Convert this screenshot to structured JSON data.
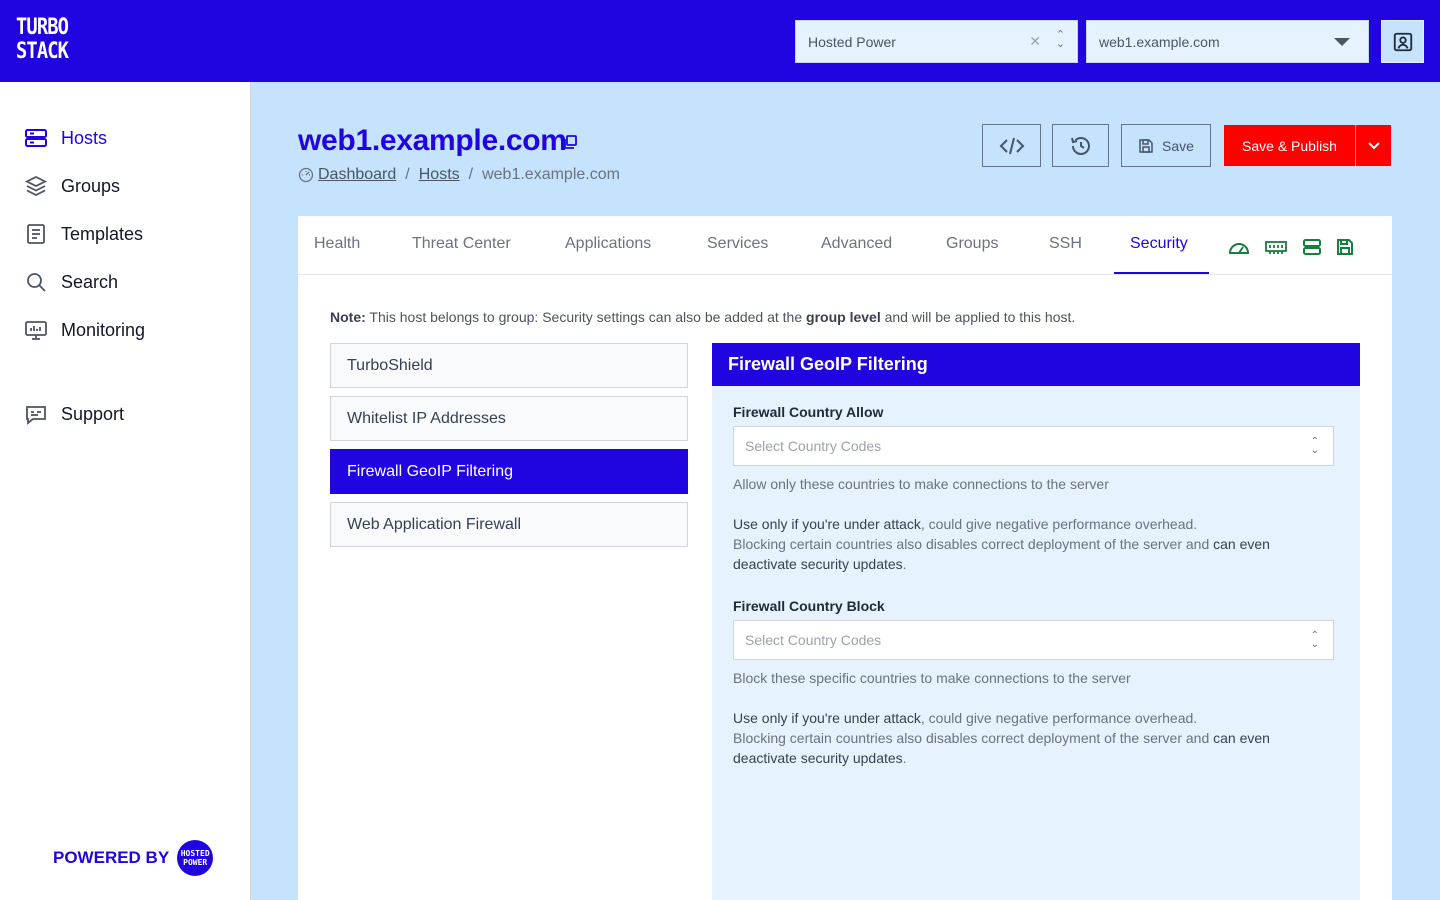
{
  "brand": {
    "logo_line1": "TURBO",
    "logo_line2": "STACK",
    "accent": "#2005e0",
    "danger": "#ff0000",
    "background": "#c5e3fc"
  },
  "topbar": {
    "org_select": {
      "value": "Hosted Power",
      "clear_icon": "close-icon",
      "toggle_icon": "chevron-updown-icon"
    },
    "host_select": {
      "value": "web1.example.com",
      "toggle_icon": "caret-down-icon"
    },
    "user_icon": "user-contact-icon"
  },
  "sidebar": {
    "items": [
      {
        "label": "Hosts",
        "icon": "server-icon",
        "active": true
      },
      {
        "label": "Groups",
        "icon": "layers-icon",
        "active": false
      },
      {
        "label": "Templates",
        "icon": "document-icon",
        "active": false
      },
      {
        "label": "Search",
        "icon": "search-icon",
        "active": false
      },
      {
        "label": "Monitoring",
        "icon": "monitor-icon",
        "active": false
      },
      {
        "label": "Support",
        "icon": "chat-icon",
        "active": false
      }
    ],
    "powered_by": "POWERED BY",
    "powered_logo": "HOSTED POWER"
  },
  "header": {
    "title": "web1.example.com",
    "breadcrumb": [
      "Dashboard",
      "Hosts",
      "web1.example.com"
    ],
    "breadcrumb_sep": "/",
    "save_label": "Save",
    "publish_label": "Save & Publish"
  },
  "tabs": [
    {
      "label": "Health",
      "active": false
    },
    {
      "label": "Threat Center",
      "active": false
    },
    {
      "label": "Applications",
      "active": false
    },
    {
      "label": "Services",
      "active": false
    },
    {
      "label": "Advanced",
      "active": false
    },
    {
      "label": "Groups",
      "active": false
    },
    {
      "label": "SSH",
      "active": false
    },
    {
      "label": "Security",
      "active": true
    }
  ],
  "tab_icons": [
    "gauge-icon",
    "memory-icon",
    "server-icon",
    "floppy-icon"
  ],
  "tab_icon_color": "#15803d",
  "note": {
    "prefix": "Note:",
    "text_before": " This host belongs to group: Security settings can also be added at the ",
    "bold": "group level",
    "text_after": " and will be applied to this host."
  },
  "security_menu": [
    {
      "label": "TurboShield",
      "active": false
    },
    {
      "label": "Whitelist IP Addresses",
      "active": false
    },
    {
      "label": "Firewall GeoIP Filtering",
      "active": true
    },
    {
      "label": "Web Application Firewall",
      "active": false
    }
  ],
  "panel": {
    "title": "Firewall GeoIP Filtering",
    "allow": {
      "label": "Firewall Country Allow",
      "placeholder": "Select Country Codes",
      "help1": "Allow only these countries to make connections to the server",
      "warn_bold": "Use only if you're under attack",
      "warn_rest": ", could give negative performance overhead.",
      "warn2_start": "Blocking certain countries also disables correct deployment of the server and ",
      "warn2_bold": "can even deactivate security updates",
      "warn2_end": "."
    },
    "block": {
      "label": "Firewall Country Block",
      "placeholder": "Select Country Codes",
      "help1": "Block these specific countries to make connections to the server",
      "warn_bold": "Use only if you're under attack",
      "warn_rest": ", could give negative performance overhead.",
      "warn2_start": "Blocking certain countries also disables correct deployment of the server and ",
      "warn2_bold": "can even deactivate security updates",
      "warn2_end": "."
    }
  }
}
